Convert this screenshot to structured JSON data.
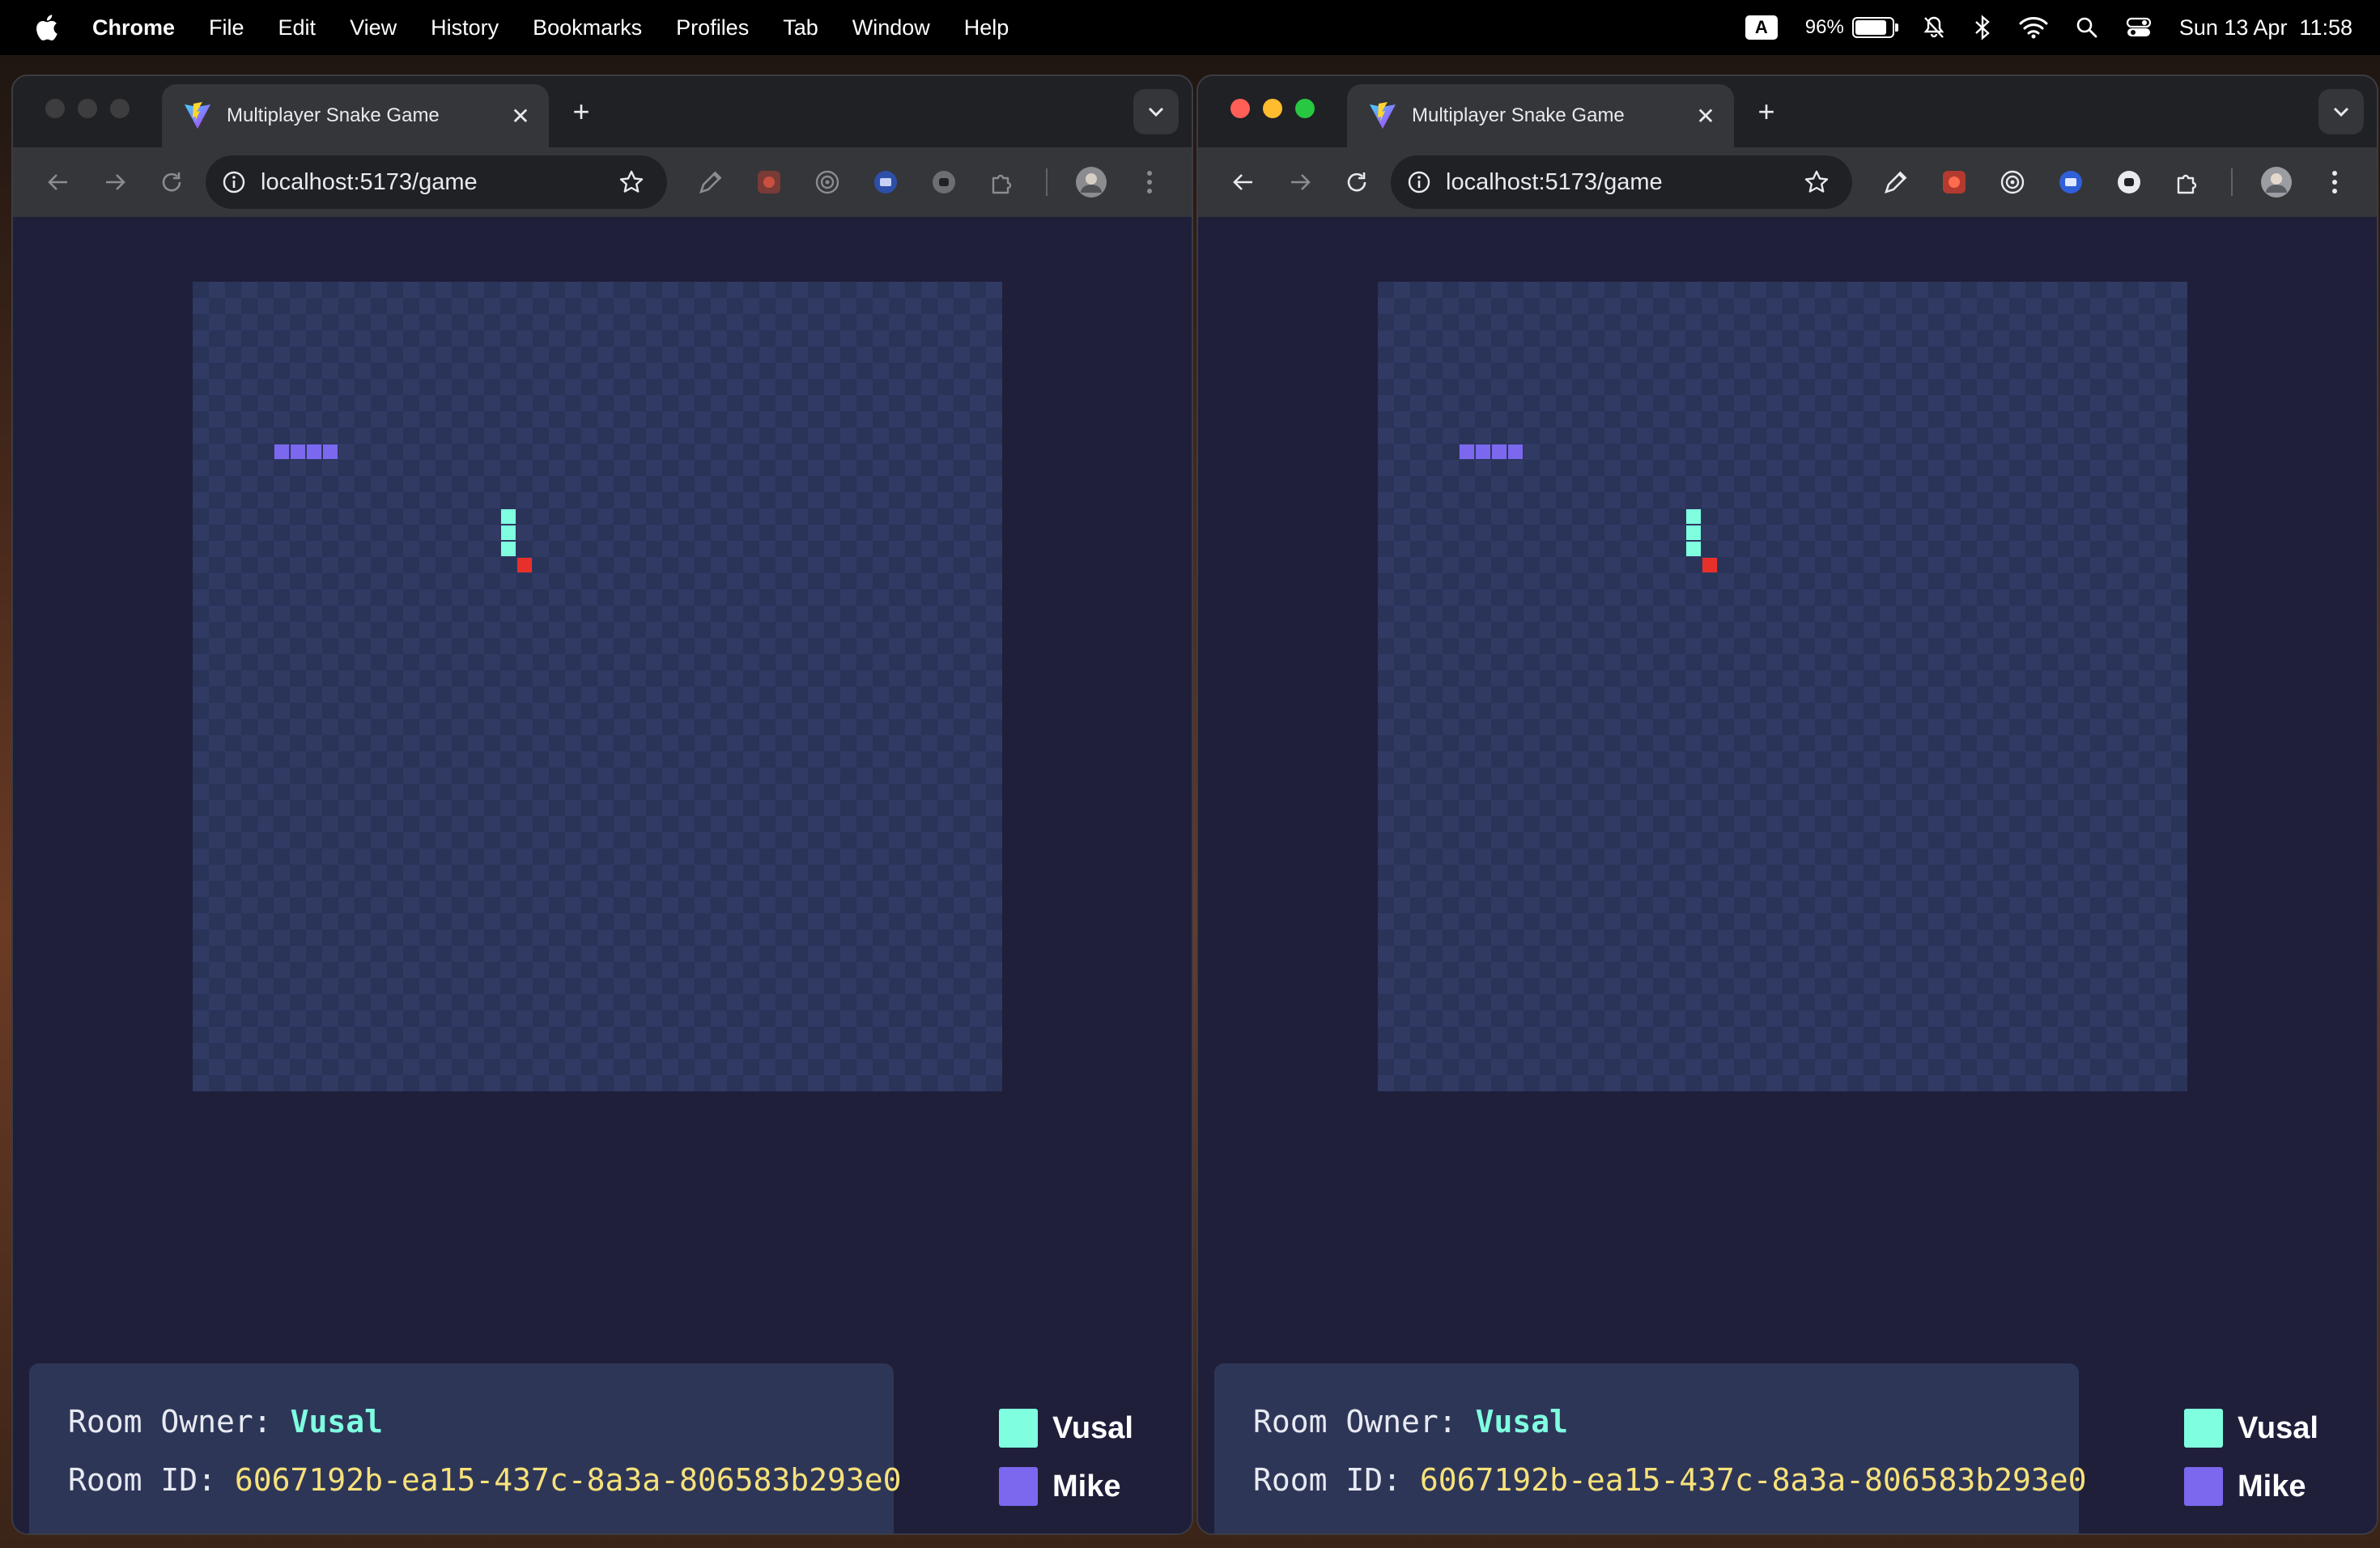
{
  "menubar": {
    "app_name": "Chrome",
    "items": [
      "File",
      "Edit",
      "View",
      "History",
      "Bookmarks",
      "Profiles",
      "Tab",
      "Window",
      "Help"
    ],
    "keyboard_indicator": "A",
    "battery_percent": "96%",
    "battery_level": 0.96,
    "datetime": "Sun 13 Apr  11:58"
  },
  "browser": {
    "tab_title": "Multiplayer Snake Game",
    "url": "localhost:5173/game"
  },
  "game": {
    "room_owner_label": "Room Owner:",
    "room_owner": "Vusal",
    "room_id_label": "Room ID:",
    "room_id": "6067192b-ea15-437c-8a3a-806583b293e0",
    "players": [
      {
        "name": "Vusal",
        "color": "#7fffe0"
      },
      {
        "name": "Mike",
        "color": "#7b68ee"
      }
    ],
    "food_color": "#e8302a"
  },
  "colors": {
    "board": "#2a3358",
    "panel": "#2e3658",
    "page": "#1f1f3a"
  }
}
